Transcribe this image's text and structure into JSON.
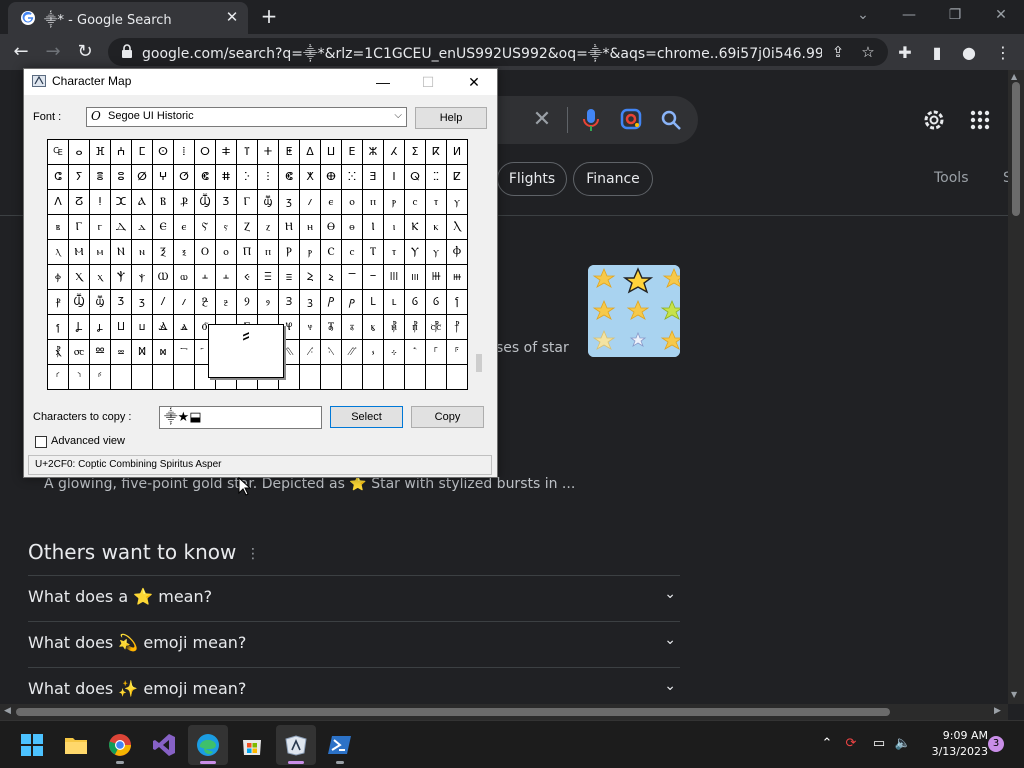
{
  "browser": {
    "tab_title": "⸎* - Google Search",
    "url": "google.com/search?q=⸎*&rlz=1C1GCEU_enUS992US992&oq=⸎*&aqs=chrome..69i57j0i546.992j1j4&s..."
  },
  "google": {
    "chips": [
      "Flights",
      "Finance"
    ],
    "tools_label": "Tools",
    "cut_label": "S",
    "snippet_tail": "ses of star",
    "description": "A glowing, five-point gold star. Depicted as ⭐ Star with stylized bursts in ...",
    "paa_title": "Others want to know",
    "paa_questions": [
      "What does a ⭐ mean?",
      "What does 💫 emoji mean?",
      "What does ✨ emoji mean?"
    ]
  },
  "charmap": {
    "title": "Character Map",
    "font_label": "Font :",
    "font_name": "Segoe UI Historic",
    "help_label": "Help",
    "copy_label": "Characters to copy :",
    "copy_value": "⸎★⬓",
    "select_label": "Select",
    "copy_button_label": "Copy",
    "advanced_label": "Advanced view",
    "status": "U+2CF0: Coptic Combining Spiritus Asper",
    "zoom_char": "⸗",
    "grid": [
      [
        "₠",
        "ⴰ",
        "ⴼ",
        "ⵄ",
        "ⵎ",
        "ⵙ",
        "ⵂ",
        "ⵔ",
        "ⵐ",
        "ⴶ",
        "ⵜ",
        "ⵟ",
        "ⵠ",
        "ⵡ",
        "ⴹ",
        "ⵣ",
        "ⵃ",
        "ⵉ",
        "ⴽ",
        "ⵍ"
      ],
      [
        "ⵛ",
        "ⵢ",
        "ⴻ",
        "ⵓ",
        "ⵁ",
        "ⵖ",
        "ⵚ",
        "ⵞ",
        "ⵌ",
        "ⴾ",
        "ⵗ",
        "ⵞ",
        "ⵅ",
        "ⴲ",
        "ⵘ",
        "ⴺ",
        "ⵏ",
        "ⵕ",
        "ⵆ",
        "ⵇ"
      ],
      [
        "ⴷ",
        "ⵒ",
        "ⵑ",
        "ⵋ",
        "Ⲁ",
        "Ⲃ",
        "Ⳁ",
        "Ⳃ",
        "Ⳅ",
        "Ⲅ",
        "ⳃ",
        "ⳅ",
        "ⳇ",
        "ⲉ",
        "ⲟ",
        "ⲡ",
        "ⲣ",
        "ⲥ",
        "ⲧ",
        "ⲩ"
      ],
      [
        "ⲃ",
        "Ⲅ",
        "ⲅ",
        "Ⲇ",
        "ⲇ",
        "Ⲉ",
        "ⲉ",
        "Ⲋ",
        "ⲋ",
        "Ⲍ",
        "ⲍ",
        "Ⲏ",
        "ⲏ",
        "Ⲑ",
        "ⲑ",
        "Ⲓ",
        "ⲓ",
        "Ⲕ",
        "ⲕ",
        "Ⲗ"
      ],
      [
        "ⲗ",
        "Ⲙ",
        "ⲙ",
        "Ⲛ",
        "ⲛ",
        "Ⲝ",
        "ⲝ",
        "Ⲟ",
        "ⲟ",
        "Ⲡ",
        "ⲡ",
        "Ⲣ",
        "ⲣ",
        "Ⲥ",
        "ⲥ",
        "Ⲧ",
        "ⲧ",
        "Ⲩ",
        "ⲩ",
        "Ⲫ"
      ],
      [
        "ⲫ",
        "Ⲭ",
        "ⲭ",
        "Ⲯ",
        "ⲯ",
        "Ⲱ",
        "ⲱ",
        "ⲳ",
        "ⲳ",
        "ⲵ",
        "Ⲷ",
        "ⲷ",
        "Ⲹ",
        "ⲹ",
        "Ⲻ",
        "ⲻ",
        "Ⲽ",
        "ⲽ",
        "Ⲿ",
        "ⲿ"
      ],
      [
        "ⳁ",
        "Ⳃ",
        "ⳃ",
        "Ⳅ",
        "ⳅ",
        "Ⳇ",
        "ⳇ",
        "Ⳉ",
        "ⳉ",
        "Ⳋ",
        "ⳋ",
        "Ⳍ",
        "ⳍ",
        "Ⳏ",
        "ⳏ",
        "Ⳑ",
        "ⳑ",
        "Ⳓ",
        "ⳓ",
        "Ⳕ"
      ],
      [
        "ⳕ",
        "Ⳗ",
        "ⳗ",
        "Ⳙ",
        "ⳙ",
        "Ⳛ",
        "ⳛ",
        "Ⳝ",
        "ⳝ",
        "Ⳟ",
        "ⳟ",
        "Ⳡ",
        "ⳡ",
        "Ⳣ",
        "ⳣ",
        "ⳤ",
        "⳥",
        "⳦",
        "⳧",
        "⳨"
      ],
      [
        "⳩",
        "⳪",
        "Ⳬ",
        "ⳬ",
        "Ⳮ",
        "ⳮ",
        "⳯",
        "⳰",
        "⳱",
        "Ⳳ",
        "ⳳ",
        "⳹",
        "⳺",
        "⳻",
        "⳼",
        "⳽",
        "⳾",
        "⳿",
        "⸀",
        "⸁"
      ],
      [
        "⸂",
        "⸃",
        "⸄",
        "",
        "",
        "",
        "",
        "",
        "",
        "",
        "",
        "",
        "",
        "",
        "",
        "",
        "",
        "",
        "",
        ""
      ]
    ]
  },
  "taskbar": {
    "time": "9:09 AM",
    "date": "3/13/2023",
    "notifications": "3"
  },
  "colors": {
    "chrome_bg": "#202124",
    "chrome_toolbar": "#35363a",
    "page_bg": "#202124",
    "accent_blue": "#8ab4f8",
    "taskbar_bg": "#1c1c1c"
  }
}
